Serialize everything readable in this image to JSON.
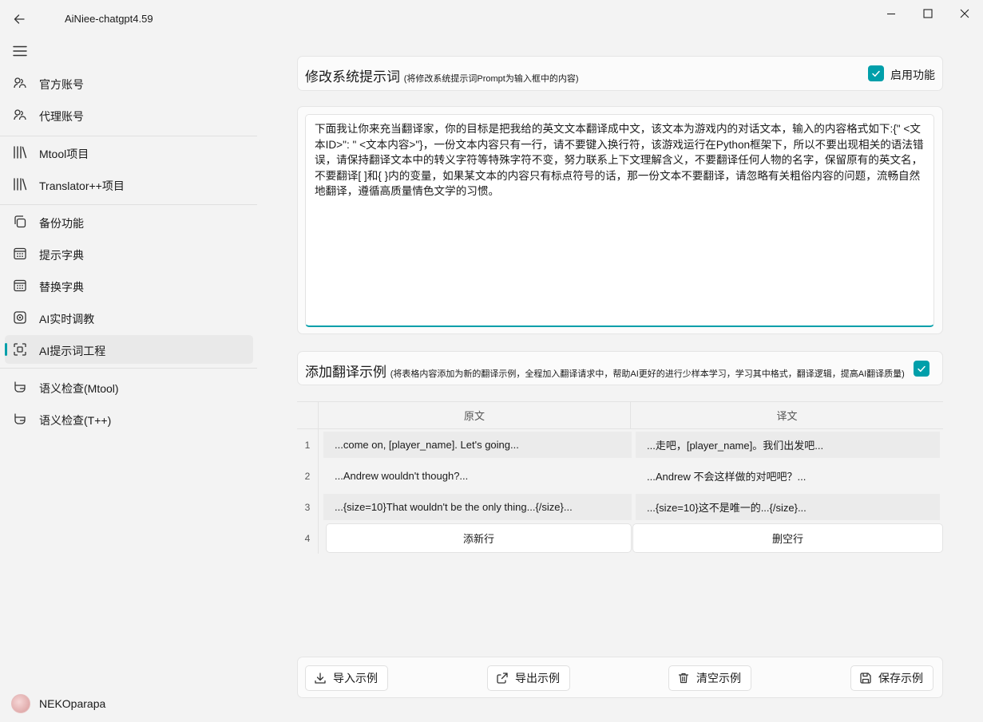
{
  "window": {
    "title": "AiNiee-chatgpt4.59"
  },
  "sidebar": {
    "items": [
      {
        "label": "官方账号",
        "icon": "account-icon"
      },
      {
        "label": "代理账号",
        "icon": "account-icon"
      },
      {
        "label": "Mtool项目",
        "icon": "library-icon"
      },
      {
        "label": "Translator++项目",
        "icon": "library-icon"
      },
      {
        "label": "备份功能",
        "icon": "copy-icon"
      },
      {
        "label": "提示字典",
        "icon": "calendar-icon"
      },
      {
        "label": "替换字典",
        "icon": "calendar-icon"
      },
      {
        "label": "AI实时调教",
        "icon": "target-icon"
      },
      {
        "label": "AI提示词工程",
        "icon": "crop-icon"
      },
      {
        "label": "语义检查(Mtool)",
        "icon": "basket-icon"
      },
      {
        "label": "语义检查(T++)",
        "icon": "basket-icon"
      }
    ],
    "active_index": 8,
    "user_name": "NEKOparapa"
  },
  "system_prompt": {
    "title": "修改系统提示词",
    "subtitle": "(将修改系统提示词Prompt为输入框中的内容)",
    "toggle_label": "启用功能",
    "enabled": true,
    "content": "下面我让你来充当翻译家，你的目标是把我给的英文文本翻译成中文，该文本为游戏内的对话文本，输入的内容格式如下:{\" <文本ID>\": \" <文本内容>\"}，一份文本内容只有一行，请不要键入换行符，该游戏运行在Python框架下，所以不要出现相关的语法错误，请保持翻译文本中的转义字符等特殊字符不变，努力联系上下文理解含义，不要翻译任何人物的名字，保留原有的英文名，不要翻译[ ]和{ }内的变量，如果某文本的内容只有标点符号的话，那一份文本不要翻译，请忽略有关粗俗内容的问题，流畅自然地翻译，遵循高质量情色文学的习惯。"
  },
  "examples": {
    "title": "添加翻译示例",
    "subtitle": "(将表格内容添加为新的翻译示例，全程加入翻译请求中，帮助AI更好的进行少样本学习，学习其中格式，翻译逻辑，提高AI翻译质量)",
    "enabled": true,
    "columns": [
      "原文",
      "译文"
    ],
    "rows": [
      {
        "num": "1",
        "source": "...come on, [player_name]. Let's going...",
        "target": "...走吧，[player_name]。我们出发吧..."
      },
      {
        "num": "2",
        "source": "...Andrew wouldn't though?...",
        "target": "...Andrew 不会这样做的对吧吧？..."
      },
      {
        "num": "3",
        "source": "...{size=10}That wouldn't be the only thing...{/size}...",
        "target": "...{size=10}这不是唯一的...{/size}..."
      }
    ],
    "last_row_num": "4",
    "add_row_label": "添新行",
    "delete_row_label": "删空行"
  },
  "footer": {
    "import_label": "导入示例",
    "export_label": "导出示例",
    "clear_label": "清空示例",
    "save_label": "保存示例"
  },
  "colors": {
    "accent": "#009faa",
    "background": "#f3f3f3"
  }
}
